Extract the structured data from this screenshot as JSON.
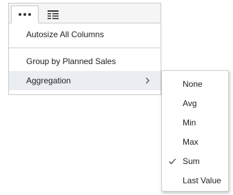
{
  "column_menu": {
    "tabs": [
      {
        "icon": "more-dots-icon",
        "selected": true
      },
      {
        "icon": "columns-list-icon",
        "selected": false
      }
    ],
    "items": [
      {
        "label": "Autosize All Columns"
      },
      {
        "label": "Group by Planned Sales"
      },
      {
        "label": "Aggregation",
        "has_submenu": true,
        "highlighted": true
      }
    ]
  },
  "aggregation_submenu": {
    "options": [
      {
        "label": "None",
        "checked": false
      },
      {
        "label": "Avg",
        "checked": false
      },
      {
        "label": "Min",
        "checked": false
      },
      {
        "label": "Max",
        "checked": false
      },
      {
        "label": "Sum",
        "checked": true
      },
      {
        "label": "Last Value",
        "checked": false
      }
    ],
    "selected": "Sum"
  },
  "colors": {
    "highlight": "#eaeef2",
    "border": "#c9c9c9",
    "tabbar": "#f5f5f5"
  }
}
